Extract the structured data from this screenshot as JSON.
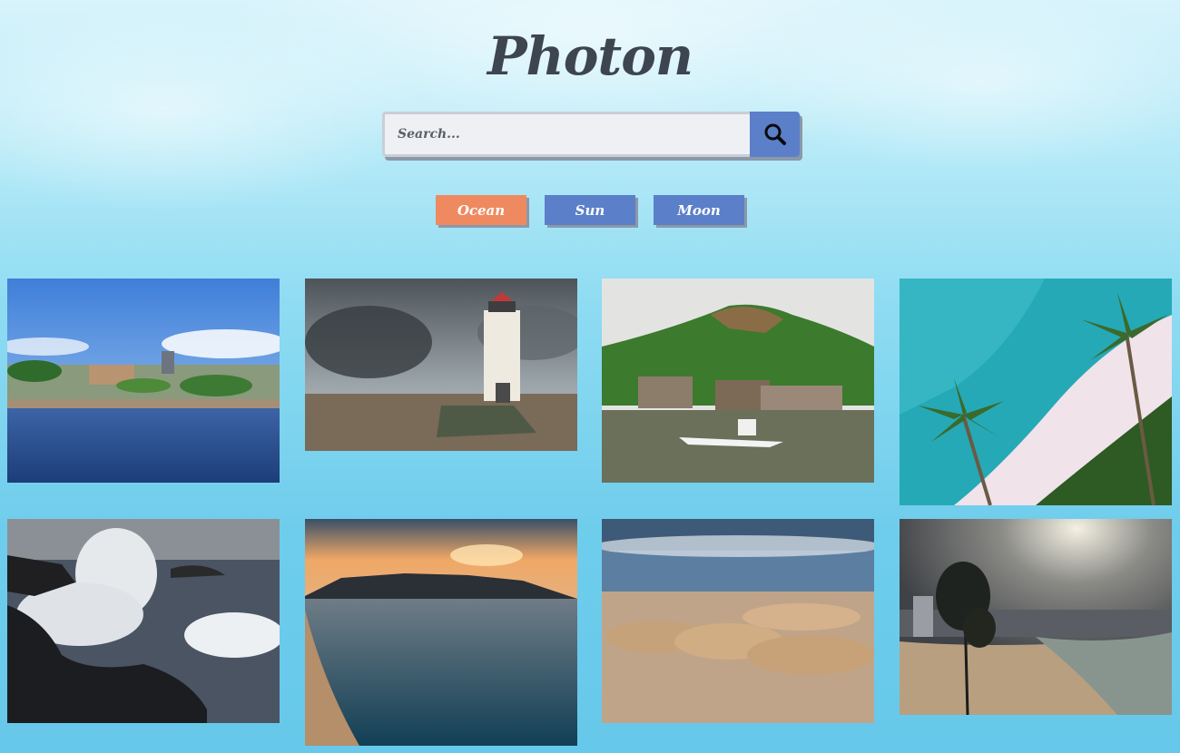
{
  "app": {
    "title": "Photon"
  },
  "search": {
    "placeholder": "Search...",
    "value": ""
  },
  "tags": [
    {
      "label": "Ocean",
      "active": true
    },
    {
      "label": "Sun",
      "active": false
    },
    {
      "label": "Moon",
      "active": false
    }
  ],
  "icons": {
    "search": "magnifier-icon"
  },
  "colors": {
    "accent": "#ef8a60",
    "button": "#5b7fc9",
    "title": "#3d4550"
  },
  "photos": [
    {
      "subject": "harbor-city"
    },
    {
      "subject": "lighthouse"
    },
    {
      "subject": "stilt-village"
    },
    {
      "subject": "palm-beach"
    },
    {
      "subject": "crashing-waves"
    },
    {
      "subject": "sunset-bay"
    },
    {
      "subject": "sea-lions"
    },
    {
      "subject": "storm-beach"
    }
  ]
}
